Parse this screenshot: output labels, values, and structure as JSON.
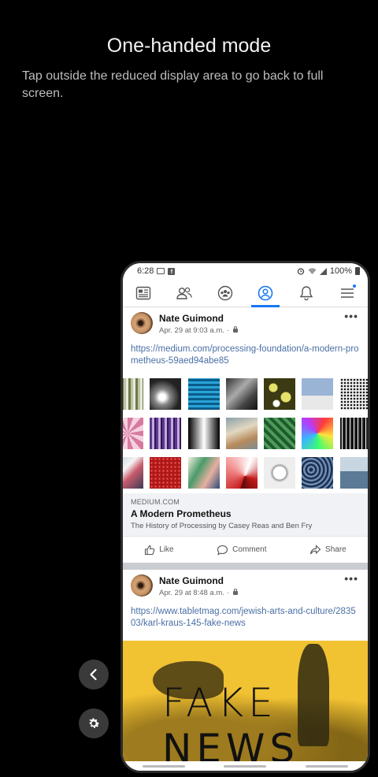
{
  "overlay": {
    "title": "One-handed mode",
    "description": "Tap outside the reduced display area to go back to full screen."
  },
  "side_controls": {
    "back_icon": "chevron-left-icon",
    "settings_icon": "gear-icon"
  },
  "status_bar": {
    "time": "6:28",
    "battery": "100%"
  },
  "fb_nav": {
    "tabs": [
      {
        "icon": "news-feed-icon",
        "active": false
      },
      {
        "icon": "friends-icon",
        "active": false
      },
      {
        "icon": "groups-icon",
        "active": false
      },
      {
        "icon": "profile-icon",
        "active": true
      },
      {
        "icon": "notifications-bell-icon",
        "active": false
      },
      {
        "icon": "menu-icon",
        "active": false
      }
    ],
    "accent": "#1877f2"
  },
  "posts": [
    {
      "author": "Nate Guimond",
      "timestamp": "Apr. 29 at 9:03 a.m.",
      "link_text": "https://medium.com/processing-foundation/a-modern-prometheus-59aed94abe85",
      "card": {
        "domain": "MEDIUM.COM",
        "headline": "A Modern Prometheus",
        "description": "The History of Processing by Casey Reas and Ben Fry"
      },
      "actions": {
        "like": "Like",
        "comment": "Comment",
        "share": "Share"
      }
    },
    {
      "author": "Nate Guimond",
      "timestamp": "Apr. 29 at 8:48 a.m.",
      "link_text": "https://www.tabletmag.com/jewish-arts-and-culture/283503/karl-kraus-145-fake-news",
      "image_text_line1": "FAKE",
      "image_text_line2": "NEWS"
    }
  ]
}
